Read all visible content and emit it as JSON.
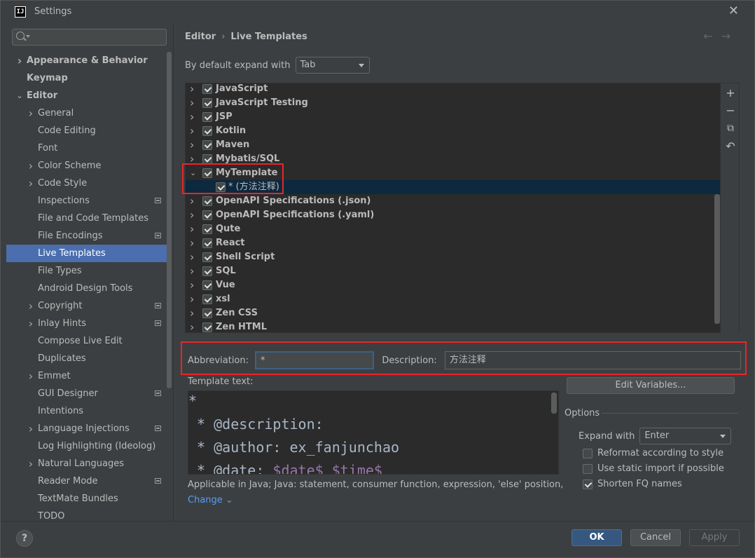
{
  "window": {
    "title": "Settings",
    "app_icon": "IJ"
  },
  "sidebar": {
    "items": [
      {
        "label": "Appearance & Behavior",
        "level": 0,
        "arrow": "right",
        "bold": true,
        "proj": false
      },
      {
        "label": "Keymap",
        "level": 0,
        "arrow": "none",
        "bold": true,
        "proj": false
      },
      {
        "label": "Editor",
        "level": 0,
        "arrow": "down",
        "bold": true,
        "proj": false
      },
      {
        "label": "General",
        "level": 1,
        "arrow": "right",
        "bold": false,
        "proj": false
      },
      {
        "label": "Code Editing",
        "level": 1,
        "arrow": "none",
        "bold": false,
        "proj": false
      },
      {
        "label": "Font",
        "level": 1,
        "arrow": "none",
        "bold": false,
        "proj": false
      },
      {
        "label": "Color Scheme",
        "level": 1,
        "arrow": "right",
        "bold": false,
        "proj": false
      },
      {
        "label": "Code Style",
        "level": 1,
        "arrow": "right",
        "bold": false,
        "proj": false
      },
      {
        "label": "Inspections",
        "level": 1,
        "arrow": "none",
        "bold": false,
        "proj": true
      },
      {
        "label": "File and Code Templates",
        "level": 1,
        "arrow": "none",
        "bold": false,
        "proj": false
      },
      {
        "label": "File Encodings",
        "level": 1,
        "arrow": "none",
        "bold": false,
        "proj": true
      },
      {
        "label": "Live Templates",
        "level": 1,
        "arrow": "none",
        "bold": false,
        "proj": false,
        "selected": true
      },
      {
        "label": "File Types",
        "level": 1,
        "arrow": "none",
        "bold": false,
        "proj": false
      },
      {
        "label": "Android Design Tools",
        "level": 1,
        "arrow": "none",
        "bold": false,
        "proj": false
      },
      {
        "label": "Copyright",
        "level": 1,
        "arrow": "right",
        "bold": false,
        "proj": true
      },
      {
        "label": "Inlay Hints",
        "level": 1,
        "arrow": "right",
        "bold": false,
        "proj": true
      },
      {
        "label": "Compose Live Edit",
        "level": 1,
        "arrow": "none",
        "bold": false,
        "proj": false
      },
      {
        "label": "Duplicates",
        "level": 1,
        "arrow": "none",
        "bold": false,
        "proj": false
      },
      {
        "label": "Emmet",
        "level": 1,
        "arrow": "right",
        "bold": false,
        "proj": false
      },
      {
        "label": "GUI Designer",
        "level": 1,
        "arrow": "none",
        "bold": false,
        "proj": true
      },
      {
        "label": "Intentions",
        "level": 1,
        "arrow": "none",
        "bold": false,
        "proj": false
      },
      {
        "label": "Language Injections",
        "level": 1,
        "arrow": "right",
        "bold": false,
        "proj": true
      },
      {
        "label": "Log Highlighting (Ideolog)",
        "level": 1,
        "arrow": "none",
        "bold": false,
        "proj": false
      },
      {
        "label": "Natural Languages",
        "level": 1,
        "arrow": "right",
        "bold": false,
        "proj": false
      },
      {
        "label": "Reader Mode",
        "level": 1,
        "arrow": "none",
        "bold": false,
        "proj": true
      },
      {
        "label": "TextMate Bundles",
        "level": 1,
        "arrow": "none",
        "bold": false,
        "proj": false
      },
      {
        "label": "TODO",
        "level": 1,
        "arrow": "none",
        "bold": false,
        "proj": false
      }
    ]
  },
  "breadcrumb": {
    "parent": "Editor",
    "sep": "›",
    "current": "Live Templates"
  },
  "expand": {
    "label": "By default expand with",
    "value": "Tab"
  },
  "templates": [
    {
      "label": "JavaScript",
      "expanded": false,
      "child": false
    },
    {
      "label": "JavaScript Testing",
      "expanded": false,
      "child": false
    },
    {
      "label": "JSP",
      "expanded": false,
      "child": false
    },
    {
      "label": "Kotlin",
      "expanded": false,
      "child": false
    },
    {
      "label": "Maven",
      "expanded": false,
      "child": false
    },
    {
      "label": "Mybatis/SQL",
      "expanded": false,
      "child": false
    },
    {
      "label": "MyTemplate",
      "expanded": true,
      "child": false
    },
    {
      "label": "* (方法注释)",
      "expanded": false,
      "child": true,
      "selected": true
    },
    {
      "label": "OpenAPI Specifications (.json)",
      "expanded": false,
      "child": false
    },
    {
      "label": "OpenAPI Specifications (.yaml)",
      "expanded": false,
      "child": false
    },
    {
      "label": "Qute",
      "expanded": false,
      "child": false
    },
    {
      "label": "React",
      "expanded": false,
      "child": false
    },
    {
      "label": "Shell Script",
      "expanded": false,
      "child": false
    },
    {
      "label": "SQL",
      "expanded": false,
      "child": false
    },
    {
      "label": "Vue",
      "expanded": false,
      "child": false
    },
    {
      "label": "xsl",
      "expanded": false,
      "child": false
    },
    {
      "label": "Zen CSS",
      "expanded": false,
      "child": false
    },
    {
      "label": "Zen HTML",
      "expanded": false,
      "child": false
    }
  ],
  "tools": {
    "add": "+",
    "remove": "−",
    "copy": "⧉",
    "restore": "↶"
  },
  "abbreviation": {
    "label": "Abbreviation:",
    "value": "*"
  },
  "description": {
    "label": "Description:",
    "value": "方法注释"
  },
  "template_text": {
    "label": "Template text:",
    "lines": [
      "*",
      " * @description:",
      " * @author: ex_fanjunchao"
    ],
    "line4_prefix": " * @date: ",
    "line4_var1": "$date$",
    "line4_var2": " $time$"
  },
  "edit_variables": "Edit Variables...",
  "applicable": "Applicable in Java; Java: statement, consumer function, expression, 'else' position, declara...",
  "change": "Change ⌄",
  "options": {
    "title": "Options",
    "expand_with_label": "Expand with",
    "expand_with_value": "Enter",
    "reformat": "Reformat according to style",
    "static_import": "Use static import if possible",
    "shorten": "Shorten FQ names"
  },
  "footer": {
    "help": "?",
    "ok": "OK",
    "cancel": "Cancel",
    "apply": "Apply"
  },
  "colors": {
    "accent": "#4b6eaf",
    "highlight": "#e8262a",
    "link": "#589df6",
    "primary_button": "#365880"
  }
}
